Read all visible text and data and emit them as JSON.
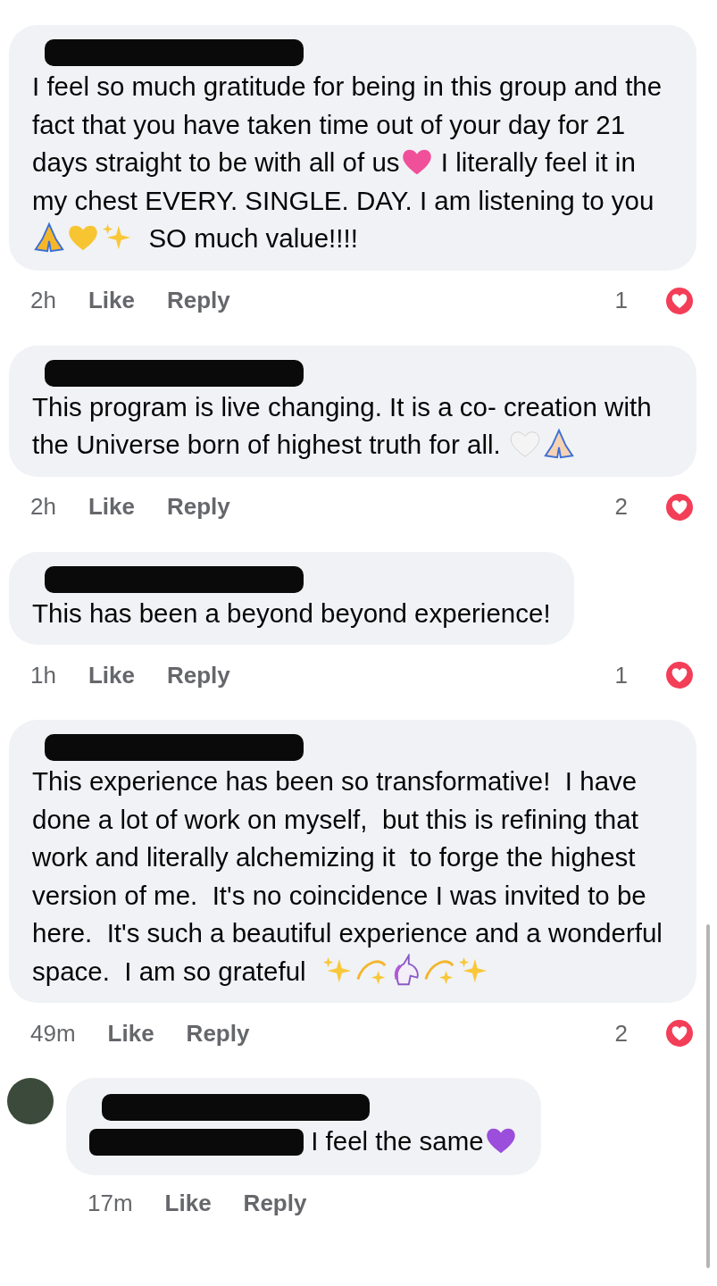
{
  "comments": [
    {
      "parts": [
        {
          "kind": "text",
          "text": "I feel so much gratitude for being in this group and the fact that you have taken time out of your day for 21 days straight to be with all of us"
        },
        {
          "kind": "heart",
          "color": "#f0509a"
        },
        {
          "kind": "text",
          "text": " I literally feel it in my chest EVERY. SINGLE. DAY. I am listening to you"
        },
        {
          "kind": "pray",
          "color": "#f5b72a"
        },
        {
          "kind": "heart",
          "color": "#f7c531"
        },
        {
          "kind": "sparkles"
        },
        {
          "kind": "text",
          "text": "  SO much value!!!!"
        }
      ],
      "time": "2h",
      "like": "Like",
      "reply": "Reply",
      "reactions": "1"
    },
    {
      "parts": [
        {
          "kind": "text",
          "text": "This program is live changing. It is a co- creation with the Universe born of highest truth for all. "
        },
        {
          "kind": "heart",
          "color": "#f4f4f4"
        },
        {
          "kind": "pray",
          "color": "#f6d2b4"
        }
      ],
      "time": "2h",
      "like": "Like",
      "reply": "Reply",
      "reactions": "2"
    },
    {
      "parts": [
        {
          "kind": "text",
          "text": "This has been a beyond beyond experience!"
        }
      ],
      "time": "1h",
      "like": "Like",
      "reply": "Reply",
      "reactions": "1"
    },
    {
      "parts": [
        {
          "kind": "text",
          "text": "This experience has been so transformative!  I have done a lot of work on myself,  but this is refining that work and literally alchemizing it  to forge the highest version of me.  It's no coincidence I was invited to be here.  It's such a beautiful experience and a wonderful space.  I am so grateful  "
        },
        {
          "kind": "sparkles"
        },
        {
          "kind": "dizzy"
        },
        {
          "kind": "unicorn"
        },
        {
          "kind": "dizzy"
        },
        {
          "kind": "sparkles"
        }
      ],
      "time": "49m",
      "like": "Like",
      "reply": "Reply",
      "reactions": "2",
      "replies": [
        {
          "parts": [
            {
              "kind": "redacted"
            },
            {
              "kind": "text",
              "text": " I feel the same"
            },
            {
              "kind": "heart",
              "color": "#9b4ddb"
            }
          ],
          "time": "17m",
          "like": "Like",
          "reply": "Reply"
        }
      ]
    }
  ]
}
